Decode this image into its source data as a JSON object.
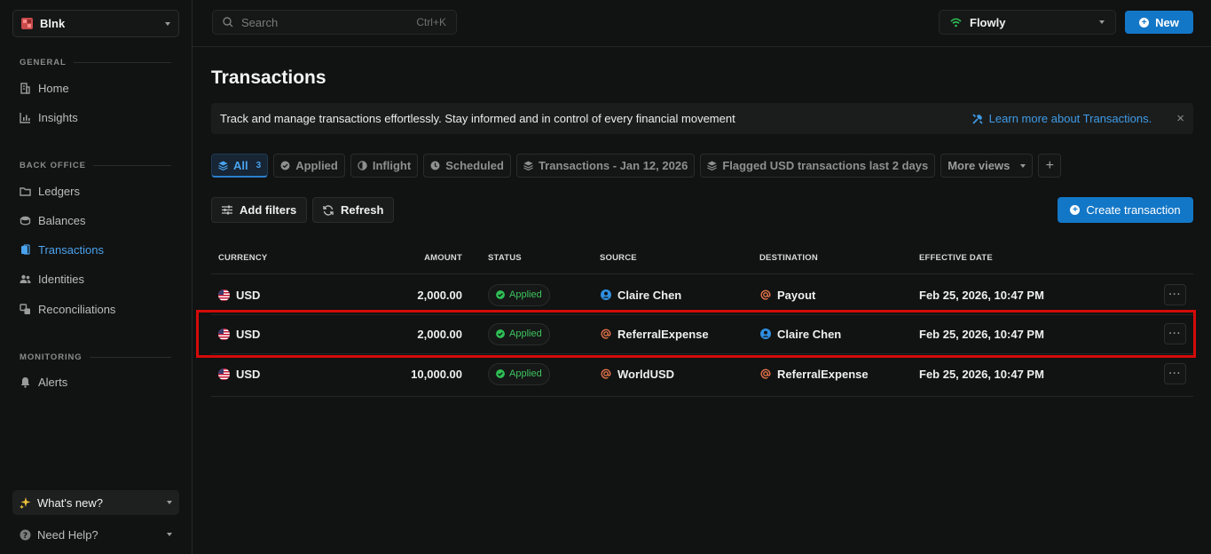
{
  "workspace": {
    "name": "Blnk"
  },
  "sidebar": {
    "sections": [
      {
        "label": "GENERAL",
        "items": [
          {
            "label": "Home",
            "icon": "building-icon"
          },
          {
            "label": "Insights",
            "icon": "bar-chart-icon"
          }
        ]
      },
      {
        "label": "BACK OFFICE",
        "items": [
          {
            "label": "Ledgers",
            "icon": "folder-icon"
          },
          {
            "label": "Balances",
            "icon": "coins-icon"
          },
          {
            "label": "Transactions",
            "icon": "transactions-icon",
            "active": true
          },
          {
            "label": "Identities",
            "icon": "users-icon"
          },
          {
            "label": "Reconciliations",
            "icon": "reconcile-icon"
          }
        ]
      },
      {
        "label": "MONITORING",
        "items": [
          {
            "label": "Alerts",
            "icon": "bell-icon"
          }
        ]
      }
    ],
    "whats_new": "What's new?",
    "need_help": "Need Help?"
  },
  "topbar": {
    "search_placeholder": "Search",
    "search_shortcut": "Ctrl+K",
    "org_name": "Flowly",
    "new_label": "New"
  },
  "page": {
    "title": "Transactions",
    "banner_text": "Track and manage transactions effortlessly. Stay informed and in control of every financial movement",
    "banner_link": "Learn more about Transactions.",
    "banner_close": "×"
  },
  "views": {
    "all": {
      "label": "All",
      "count": "3"
    },
    "applied": "Applied",
    "inflight": "Inflight",
    "scheduled": "Scheduled",
    "saved_1": "Transactions - Jan 12, 2026",
    "saved_2": "Flagged USD transactions last 2 days",
    "more": "More views",
    "add": "+"
  },
  "toolbar": {
    "add_filters": "Add filters",
    "refresh": "Refresh",
    "create_transaction": "Create transaction"
  },
  "table": {
    "headers": {
      "currency": "CURRENCY",
      "amount": "AMOUNT",
      "status": "STATUS",
      "source": "SOURCE",
      "destination": "DESTINATION",
      "effective_date": "EFFECTIVE DATE"
    },
    "more_label": "···",
    "rows": [
      {
        "currency": "USD",
        "amount": "2,000.00",
        "status": "Applied",
        "source": "Claire Chen",
        "source_type": "identity",
        "destination": "Payout",
        "destination_type": "balance",
        "date": "Feb 25, 2026, 10:47 PM"
      },
      {
        "currency": "USD",
        "amount": "2,000.00",
        "status": "Applied",
        "source": "ReferralExpense",
        "source_type": "balance",
        "destination": "Claire Chen",
        "destination_type": "identity",
        "date": "Feb 25, 2026, 10:47 PM"
      },
      {
        "currency": "USD",
        "amount": "10,000.00",
        "status": "Applied",
        "source": "WorldUSD",
        "source_type": "balance",
        "destination": "ReferralExpense",
        "destination_type": "balance",
        "date": "Feb 25, 2026, 10:47 PM"
      }
    ]
  },
  "colors": {
    "accent": "#1377c7",
    "link": "#3f9be6",
    "success": "#2fbf55",
    "highlight": "#d40a0a",
    "balance_icon": "#e0734a"
  }
}
